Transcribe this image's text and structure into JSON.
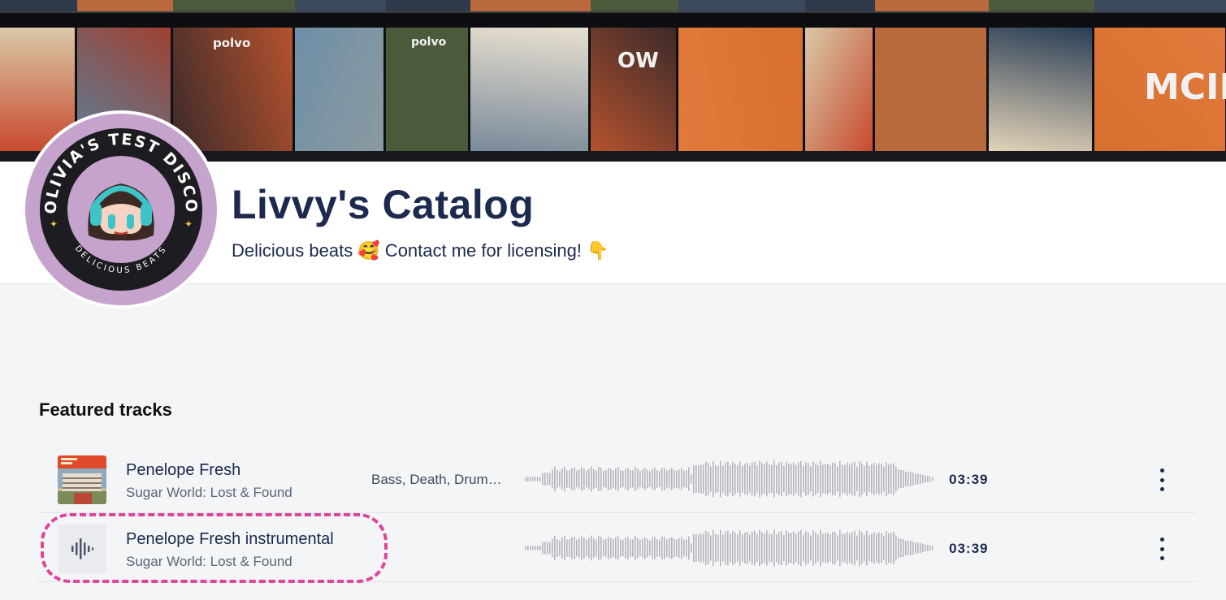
{
  "profile": {
    "title": "Livvy's Catalog",
    "subtitle": "Delicious beats 🥰 Contact me for licensing! 👇",
    "avatar_text_top": "OLIVIA'S TEST DISCO",
    "avatar_text_bottom": "DELICIOUS BEATS"
  },
  "banner_records": [
    "polvo",
    "polvo",
    "OW",
    "MCID"
  ],
  "featured": {
    "heading": "Featured tracks",
    "tracks": [
      {
        "title": "Penelope Fresh",
        "album": "Sugar World: Lost & Found",
        "tags": "Bass, Death, Drum…",
        "duration": "03:39",
        "thumb": "album-art"
      },
      {
        "title": "Penelope Fresh instrumental",
        "album": "Sugar World: Lost & Found",
        "tags": "",
        "duration": "03:39",
        "thumb": "waveform-icon"
      }
    ]
  },
  "colors": {
    "accent_highlight": "#e0449b",
    "avatar_bg": "#c6a3cd",
    "title": "#1b2a4e"
  }
}
